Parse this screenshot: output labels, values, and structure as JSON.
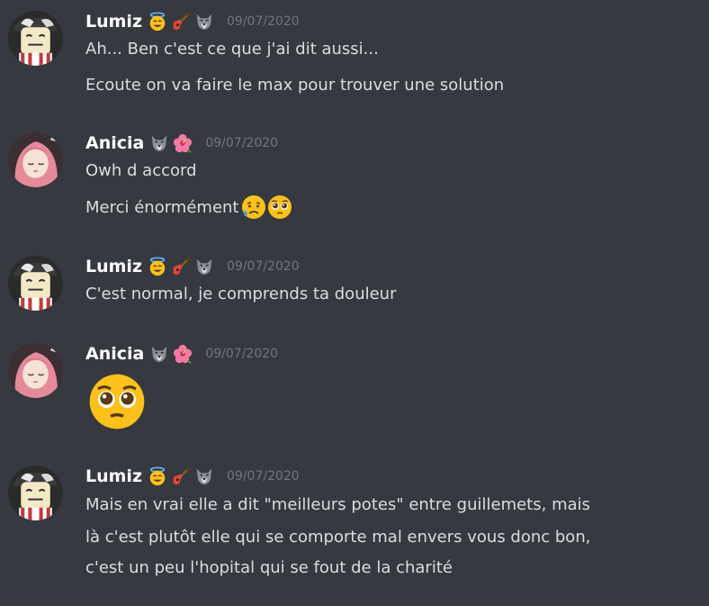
{
  "messages": [
    {
      "author": "Lumiz",
      "badges": [
        "halo-smile-icon",
        "guitar-icon",
        "wolf-icon"
      ],
      "timestamp": "09/07/2020",
      "lines": [
        "Ah... Ben c'est ce que j'ai dit aussi...",
        "Ecoute on va faire le max pour trouver une solution"
      ]
    },
    {
      "author": "Anicia",
      "badges": [
        "wolf-icon",
        "hibiscus-icon"
      ],
      "timestamp": "09/07/2020",
      "lines": [
        "Owh d accord",
        "Merci énormément"
      ],
      "inline_emojis": [
        "sad-tear-emoji",
        "pleading-face-emoji"
      ]
    },
    {
      "author": "Lumiz",
      "badges": [
        "halo-smile-icon",
        "guitar-icon",
        "wolf-icon"
      ],
      "timestamp": "09/07/2020",
      "lines": [
        "C'est normal, je comprends ta douleur"
      ]
    },
    {
      "author": "Anicia",
      "badges": [
        "wolf-icon",
        "hibiscus-icon"
      ],
      "timestamp": "09/07/2020",
      "big_emoji": "pleading-face-emoji"
    },
    {
      "author": "Lumiz",
      "badges": [
        "halo-smile-icon",
        "guitar-icon",
        "wolf-icon"
      ],
      "timestamp": "09/07/2020",
      "lines": [
        "Mais en vrai elle a dit \"meilleurs potes\" entre guillemets, mais",
        "là c'est plutôt elle qui se comporte mal envers vous donc bon,",
        "c'est un peu l'hopital qui se fout de la charité"
      ]
    }
  ],
  "colors": {
    "background": "#36393f",
    "username": "#ffffff",
    "text": "#dcddde",
    "timestamp": "#72767d"
  }
}
